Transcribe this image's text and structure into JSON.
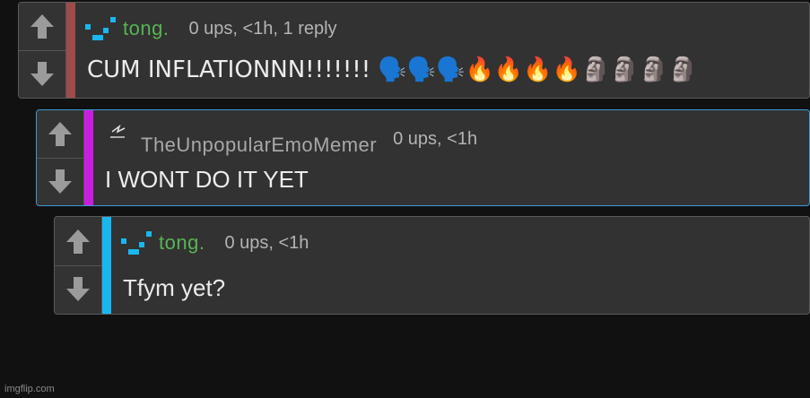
{
  "comments": [
    {
      "username": "tong.",
      "meta": "0 ups, <1h, 1 reply",
      "body": "CUM INFLATIONNN!!!!!!! 🗣️🗣️🗣️🔥🔥🔥🔥🗿🗿🗿🗿",
      "depth_color": "#a04a4a",
      "username_color": "#57b453",
      "avatar": "pixel-stairs-icon"
    },
    {
      "username": "TheUnpopularEmoMemer",
      "meta": "0 ups, <1h",
      "body": "I WONT DO IT YET",
      "depth_color": "#c91ee0",
      "username_color": "#a8a8a8",
      "avatar": "lightning-scribble-icon"
    },
    {
      "username": "tong.",
      "meta": "0 ups, <1h",
      "body": "Tfym yet?",
      "depth_color": "#19b7f0",
      "username_color": "#57b453",
      "avatar": "pixel-stairs-icon"
    }
  ],
  "watermark": "imgflip.com"
}
